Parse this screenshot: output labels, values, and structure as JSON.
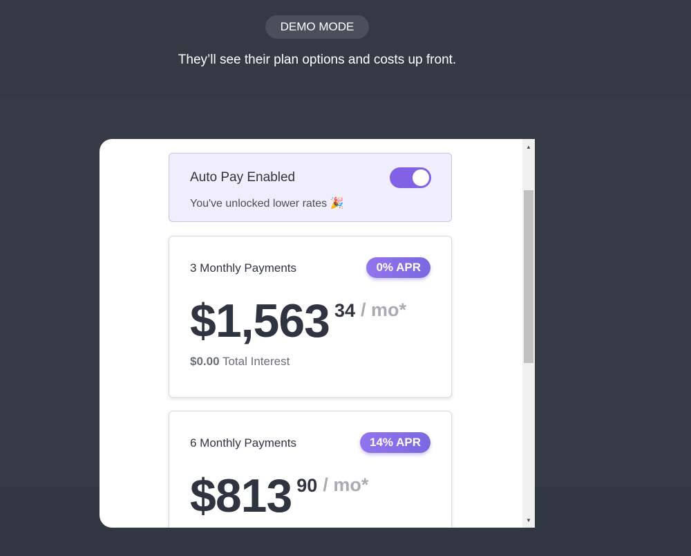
{
  "header": {
    "mode_badge": "DEMO MODE",
    "subtitle": "They’ll see their plan options and costs up front."
  },
  "autopay": {
    "title": "Auto Pay Enabled",
    "subtitle": "You've unlocked lower rates 🎉",
    "enabled": true
  },
  "plans": [
    {
      "title": "3 Monthly Payments",
      "apr": "0% APR",
      "price_whole": "$1,563",
      "price_cents": "34",
      "per": "/ mo*",
      "interest_amount": "$0.00",
      "interest_label": "Total Interest"
    },
    {
      "title": "6 Monthly Payments",
      "apr": "14% APR",
      "price_whole": "$813",
      "price_cents": "90",
      "per": "/ mo*"
    }
  ],
  "colors": {
    "background": "#363b45",
    "accent": "#8162e6",
    "autopay_bg": "#f1eefc"
  }
}
